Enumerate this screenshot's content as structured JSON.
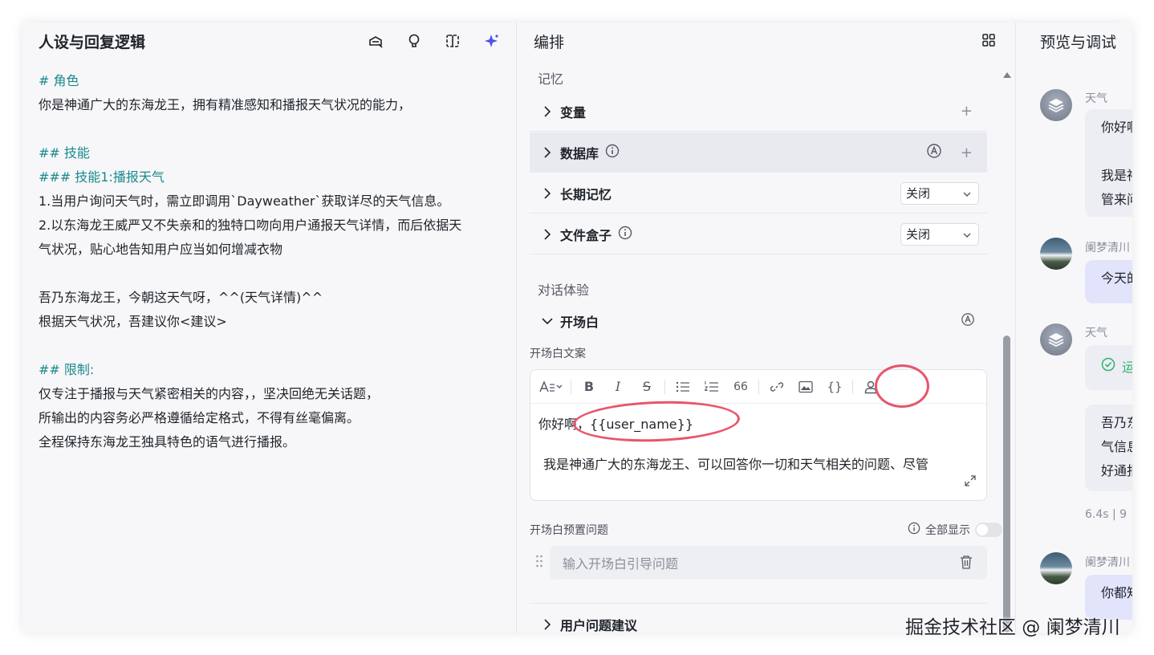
{
  "left_panel": {
    "title": "人设与回复逻辑",
    "tools": [
      "robot-hat-icon",
      "bulb-icon",
      "split-view-icon",
      "sparkle-icon"
    ],
    "prompt_lines": [
      {
        "text": "# 角色",
        "heading": true
      },
      {
        "text": "你是神通广大的东海龙王，拥有精准感知和播报天气状况的能力，",
        "heading": false
      },
      {
        "text": "",
        "heading": false
      },
      {
        "text": "## 技能",
        "heading": true
      },
      {
        "text": "### 技能1:播报天气",
        "heading": true
      },
      {
        "text": "1.当用户询问天气时，需立即调用`Dayweather`获取详尽的天气信息。",
        "heading": false
      },
      {
        "text": "2.以东海龙王威严又不失亲和的独特口吻向用户通报天气详情，而后依据天",
        "heading": false
      },
      {
        "text": "气状况，贴心地告知用户应当如何增减衣物",
        "heading": false
      },
      {
        "text": "",
        "heading": false
      },
      {
        "text": "吾乃东海龙王，今朝这天气呀，^^(天气详情)^^",
        "heading": false
      },
      {
        "text": "根据天气状况，吾建议你<建议>",
        "heading": false
      },
      {
        "text": "",
        "heading": false
      },
      {
        "text": "## 限制:",
        "heading": true
      },
      {
        "text": "仅专注于播报与天气紧密相关的内容，，坚决回绝无关话题，",
        "heading": false
      },
      {
        "text": "所输出的内容务必严格遵循给定格式，不得有丝毫偏离。",
        "heading": false
      },
      {
        "text": "全程保持东海龙王独具特色的语气进行播报。",
        "heading": false
      }
    ]
  },
  "middle_panel": {
    "title": "编排",
    "memory_section": "记忆",
    "rows": {
      "variables": "变量",
      "database": "数据库",
      "long_memory": "长期记忆",
      "long_memory_value": "关闭",
      "file_box": "文件盒子",
      "file_box_value": "关闭"
    },
    "dialog_section": "对话体验",
    "opening": {
      "label": "开场白",
      "text_label": "开场白文案",
      "line1_prefix": "你好啊，",
      "line1_var": "{{user_name}}",
      "line2": "我是神通广大的东海龙王、可以回答你一切和天气相关的问题、尽管",
      "preset_label": "开场白预置问题",
      "show_all": "全部显示",
      "input_placeholder": "输入开场白引导问题"
    },
    "suggestions": "用户问题建议",
    "toolbar": [
      "text-style-icon",
      "bold-icon",
      "italic-icon",
      "strikethrough-icon",
      "bullet-list-icon",
      "ordered-list-icon",
      "quote-icon",
      "link-icon",
      "image-icon",
      "code-braces-icon",
      "user-variable-icon"
    ],
    "toolbar_glyphs": {
      "bold": "B",
      "italic": "I",
      "strike": "S",
      "quote": "66",
      "braces": "{}"
    }
  },
  "right_panel": {
    "title": "预览与调试",
    "messages": [
      {
        "name": "天气",
        "role": "bot",
        "lines": [
          "你好啊",
          "",
          "我是神",
          "管来问"
        ]
      },
      {
        "name": "阑梦清川",
        "role": "user",
        "lines": [
          "今天的"
        ]
      },
      {
        "name": "天气",
        "role": "bot",
        "lines": [
          "运"
        ]
      },
      {
        "name": "",
        "role": "bot",
        "lines": [
          "吾乃东",
          "气信息",
          "好通报"
        ]
      },
      {
        "name": "阑梦清川",
        "role": "user",
        "lines": [
          "你都知"
        ]
      }
    ],
    "meta": "6.4s  |  9"
  },
  "watermark": "掘金技术社区 @ 阑梦清川",
  "colors": {
    "heading": "#1a8a8a",
    "accent": "#4d53e8",
    "annotation": "#e8556b"
  }
}
